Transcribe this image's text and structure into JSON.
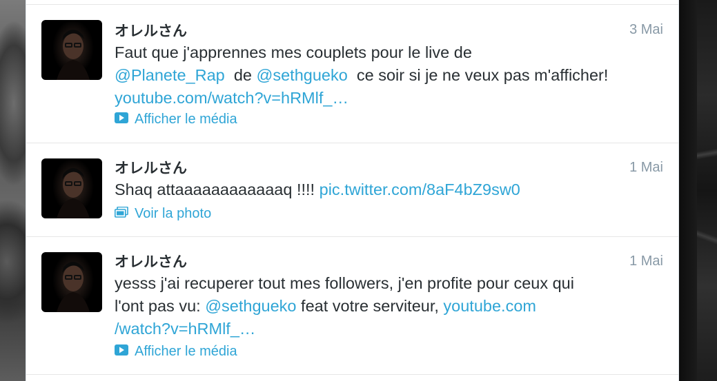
{
  "tweets": [
    {
      "author": "オレルさん",
      "date": "3 Mai",
      "line1": "Faut que j'apprennes mes couplets pour le live de",
      "mention1": "@Planete_Rap",
      "mid": "de",
      "mention2": "@sethgueko",
      "after": "ce soir si je ne veux pas m'afficher!",
      "url": "youtube.com/watch?v=hRMlf_…",
      "action_label": "Afficher le média",
      "action_icon": "play-icon"
    },
    {
      "author": "オレルさん",
      "date": "1 Mai",
      "text": "Shaq attaaaaaaaaaaaaq !!!!",
      "url": "pic.twitter.com/8aF4bZ9sw0",
      "action_label": "Voir la photo",
      "action_icon": "photo-icon"
    },
    {
      "author": "オレルさん",
      "date": "1 Mai",
      "line1": "yesss j'ai recuperer tout mes followers, j'en profite pour ceux qui",
      "prefix": "l'ont pas vu:",
      "mention": "@sethgueko",
      "mid": "feat votre serviteur,",
      "url_part1": "youtube.com",
      "url_part2": "/watch?v=hRMlf_…",
      "action_label": "Afficher le média",
      "action_icon": "play-icon"
    }
  ],
  "colors": {
    "link": "#2fa5d6",
    "text": "#292f33",
    "muted": "#8899a6"
  }
}
